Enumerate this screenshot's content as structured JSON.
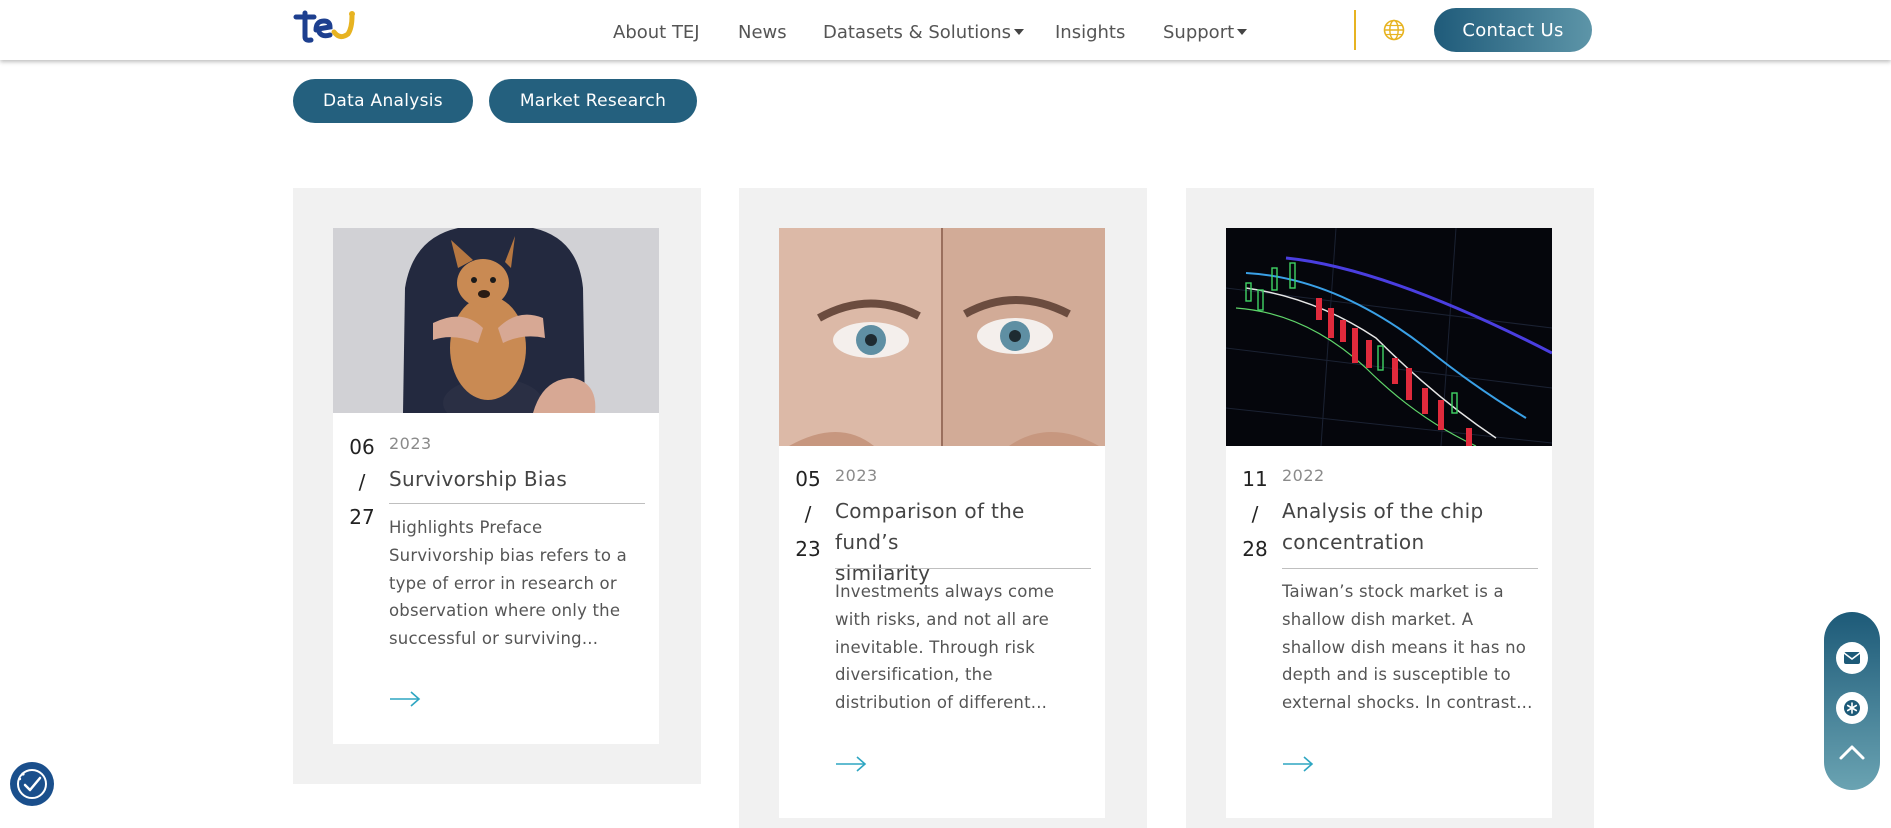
{
  "header": {
    "nav": [
      {
        "label": "About TEJ",
        "dropdown": false
      },
      {
        "label": "News",
        "dropdown": false
      },
      {
        "label": "Datasets & Solutions",
        "dropdown": true
      },
      {
        "label": "Insights",
        "dropdown": false
      },
      {
        "label": "Support",
        "dropdown": true
      }
    ],
    "contact_label": "Contact Us"
  },
  "tags": [
    "Data Analysis",
    "Market Research"
  ],
  "cards": [
    {
      "month": "06",
      "sep": "/",
      "day": "27",
      "year": "2023",
      "title_lines": [
        "Survivorship Bias"
      ],
      "excerpt_lines": [
        "Highlights Preface",
        "Survivorship bias refers to a",
        "type of error in research or",
        "observation where only the",
        "successful or surviving..."
      ]
    },
    {
      "month": "05",
      "sep": "/",
      "day": "23",
      "year": "2023",
      "title_lines": [
        "Comparison of the fund’s",
        "similarity"
      ],
      "excerpt_lines": [
        "Investments always come",
        "with risks, and not all are",
        "inevitable. Through risk",
        "diversification, the",
        "distribution of different..."
      ]
    },
    {
      "month": "11",
      "sep": "/",
      "day": "28",
      "year": "2022",
      "title_lines": [
        "Analysis of the chip",
        "concentration"
      ],
      "excerpt_lines": [
        "Taiwan’s stock market is a",
        "shallow dish market. A",
        "shallow dish means it has no",
        "depth and is susceptible to",
        "external shocks. In contrast..."
      ]
    }
  ],
  "colors": {
    "accent": "#24607e",
    "gold": "#e7b321",
    "arrow": "#2ea6c2",
    "card_bg": "#f1f1f1"
  }
}
